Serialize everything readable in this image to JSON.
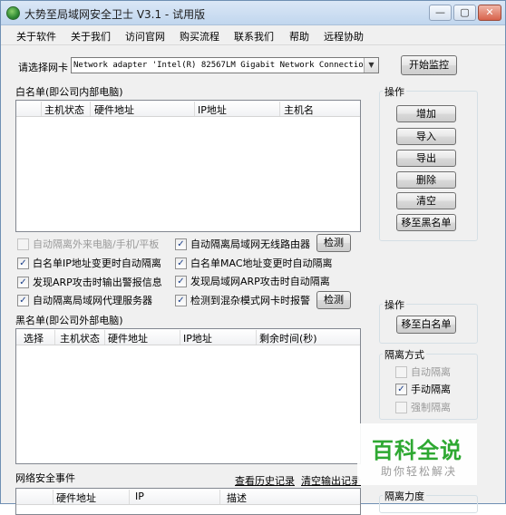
{
  "window": {
    "title": "大势至局域网安全卫士 V3.1 - 试用版",
    "minimize": "—",
    "maximize": "▢",
    "close": "✕"
  },
  "menu": [
    "关于软件",
    "关于我们",
    "访问官网",
    "购买流程",
    "联系我们",
    "帮助",
    "远程协助"
  ],
  "adapter": {
    "label": "请选择网卡",
    "selected": "Network adapter 'Intel(R) 82567LM Gigabit Network Connection'",
    "dropdown_icon": "▼",
    "start_button": "开始监控"
  },
  "whitelist": {
    "title": "白名单(即公司内部电脑)",
    "columns": [
      "主机状态",
      "硬件地址",
      "IP地址",
      "主机名"
    ]
  },
  "whitelist_ops": {
    "title": "操作",
    "buttons": [
      "增加",
      "导入",
      "导出",
      "删除",
      "清空",
      "移至黑名单"
    ]
  },
  "options": {
    "opt1": {
      "label": "自动隔离外来电脑/手机/平板",
      "checked": false,
      "disabled": true
    },
    "opt2": {
      "label": "自动隔离局域网无线路由器",
      "checked": true
    },
    "opt3": {
      "label": "白名单IP地址变更时自动隔离",
      "checked": true
    },
    "opt4": {
      "label": "白名单MAC地址变更时自动隔离",
      "checked": true
    },
    "opt5": {
      "label": "发现ARP攻击时输出警报信息",
      "checked": true
    },
    "opt6": {
      "label": "发现局域网ARP攻击时自动隔离",
      "checked": true
    },
    "opt7": {
      "label": "自动隔离局域网代理服务器",
      "checked": true
    },
    "opt8": {
      "label": "检测到混杂模式网卡时报警",
      "checked": true
    },
    "detect_button_1": "检测",
    "detect_button_2": "检测",
    "check_mark": "✓"
  },
  "blacklist": {
    "title": "黑名单(即公司外部电脑)",
    "columns": [
      "选择",
      "主机状态",
      "硬件地址",
      "IP地址",
      "剩余时间(秒)"
    ]
  },
  "blacklist_ops": {
    "title": "操作",
    "button": "移至白名单"
  },
  "isolation_mode": {
    "title": "隔离方式",
    "options": [
      {
        "label": "自动隔离",
        "checked": false,
        "disabled": true
      },
      {
        "label": "手动隔离",
        "checked": true,
        "disabled": false
      },
      {
        "label": "强制隔离",
        "checked": false,
        "disabled": true
      }
    ]
  },
  "events": {
    "title": "网络安全事件",
    "history_link": "查看历史记录",
    "clear_link": "清空输出记录",
    "columns": [
      "硬件地址",
      "IP",
      "描述"
    ]
  },
  "isolation_strength": {
    "title": "隔离力度"
  },
  "watermark": {
    "main": "百科全说",
    "sub": "助你轻松解决"
  }
}
